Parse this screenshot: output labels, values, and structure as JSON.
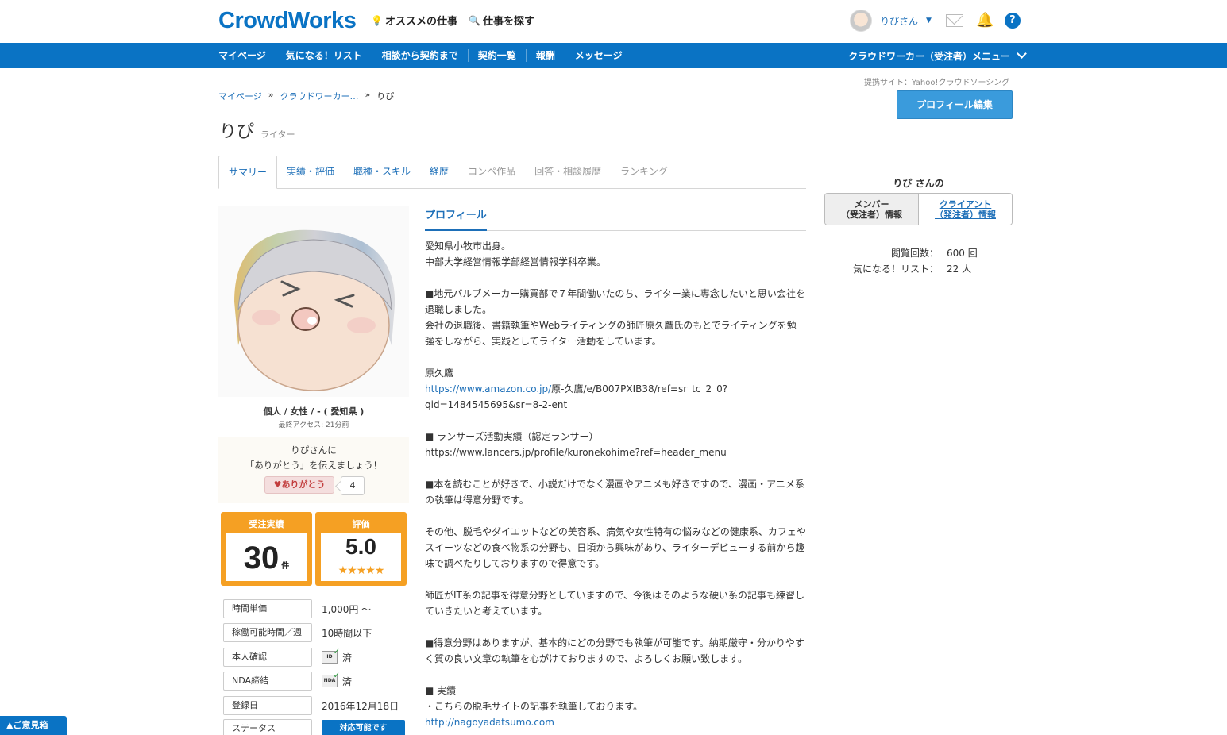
{
  "header": {
    "logo": "CrowdWorks",
    "nav": [
      {
        "icon": "lightbulb-icon",
        "label": "オススメの仕事"
      },
      {
        "icon": "search-icon",
        "label": "仕事を探す"
      }
    ],
    "user_name": "りぴさん"
  },
  "bluenav": {
    "items": [
      "マイページ",
      "気になる！リスト",
      "相談から契約まで",
      "契約一覧",
      "報酬",
      "メッセージ"
    ],
    "menu_label": "クラウドワーカー（受注者）メニュー"
  },
  "partner_text": "提携サイト：Yahoo!クラウドソーシング",
  "breadcrumb": [
    "マイページ",
    "クラウドワーカー…",
    "りぴ"
  ],
  "breadcrumb_sep": "»",
  "page": {
    "name": "りぴ",
    "role": "ライター",
    "edit_button": "プロフィール編集"
  },
  "tabs": [
    "サマリー",
    "実績・評価",
    "職種・スキル",
    "経歴",
    "コンペ作品",
    "回答・相談履歴",
    "ランキング"
  ],
  "left": {
    "meta": "個人 / 女性 / - ( 愛知県 )",
    "last_access": "最終アクセス: 21分前",
    "thanks_line1": "りぴさんに",
    "thanks_line2": "「ありがとう」を伝えましょう！",
    "thanks_button": "ありがとう",
    "thanks_count": "4",
    "stats": {
      "orders_label": "受注実績",
      "orders_value": "30",
      "orders_unit": "件",
      "rating_label": "評価",
      "rating_value": "5.0",
      "rating_stars": 5
    },
    "info": [
      {
        "label": "時間単価",
        "value": "1,000円 〜"
      },
      {
        "label": "稼働可能時間／週",
        "value": "10時間以下"
      },
      {
        "label": "本人確認",
        "value": "済",
        "icon": "id-verified-icon"
      },
      {
        "label": "NDA締結",
        "value": "済",
        "icon": "nda-verified-icon"
      },
      {
        "label": "登録日",
        "value": "2016年12月18日"
      },
      {
        "label": "ステータス",
        "value": "対応可能です"
      }
    ],
    "feedback": "▲ご意見箱"
  },
  "profile": {
    "heading": "プロフィール",
    "lines": [
      "愛知県小牧市出身。",
      "中部大学経営情報学部経営情報学科卒業。",
      "",
      "■地元バルブメーカー購買部で７年間働いたのち、ライター業に専念したいと思い会社を",
      "退職しました。",
      "会社の退職後、書籍執筆やWebライティングの師匠原久鷹氏のもとでライティングを勉",
      "強をしながら、実践としてライター活動をしています。",
      "",
      "原久鷹",
      "",
      "qid=1484545695&sr=8-2-ent",
      "",
      "■ ランサーズ活動実績（認定ランサー）",
      "https://www.lancers.jp/profile/kuronekohime?ref=header_menu",
      "",
      "■本を読むことが好きで、小説だけでなく漫画やアニメも好きですので、漫画・アニメ系",
      "の執筆は得意分野です。",
      "",
      "その他、脱毛やダイエットなどの美容系、病気や女性特有の悩みなどの健康系、カフェや",
      "スイーツなどの食べ物系の分野も、日頃から興味があり、ライターデビューする前から趣",
      "味で調べたりしておりますので得意です。",
      "",
      "師匠がIT系の記事を得意分野としていますので、今後はそのような硬い系の記事も練習し",
      "ていきたいと考えています。",
      "",
      "■得意分野はありますが、基本的にどの分野でも執筆が可能です。納期厳守・分かりやす",
      "く質の良い文章の執筆を心がけておりますので、よろしくお願い致します。",
      "",
      "■ 実績",
      "・こちらの脱毛サイトの記事を執筆しております。",
      ""
    ],
    "amazon_link": "https://www.amazon.co.jp/",
    "amazon_rest": "原-久鷹/e/B007PXIB38/ref=sr_tc_2_0?",
    "nagoya_link": "http://nagoyadatsumo.com"
  },
  "right": {
    "name_suffix": "りぴ さんの",
    "toggle_member_1": "メンバー",
    "toggle_member_2": "（受注者）情報",
    "toggle_client_1": "クライアント",
    "toggle_client_2": "（発注者）情報",
    "views_label": "閲覧回数：",
    "views_value": "600 回",
    "fav_label": "気になる！リスト：",
    "fav_value": "22 人"
  }
}
